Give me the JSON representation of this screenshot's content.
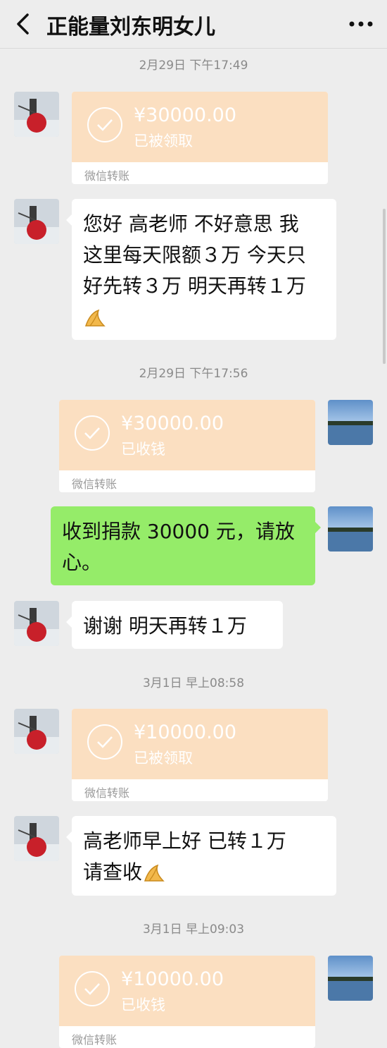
{
  "header": {
    "title": "正能量刘东明女儿"
  },
  "timestamps": [
    "2月29日 下午17:49",
    "2月29日 下午17:56",
    "3月1日 早上08:58",
    "3月1日 早上09:03"
  ],
  "messages": {
    "m1": {
      "amount": "¥30000.00",
      "status": "已被领取",
      "label": "微信转账"
    },
    "m2": {
      "lines": [
        "您好 高老师  不好意思  我",
        "这里每天限额３万  今天只",
        "好先转３万  明天再转１万"
      ]
    },
    "m3": {
      "amount": "¥30000.00",
      "status": "已收钱",
      "label": "微信转账"
    },
    "m4": {
      "lines": [
        "收到捐款 30000 元，请放",
        "心。"
      ]
    },
    "m5": {
      "lines": [
        "谢谢  明天再转１万"
      ]
    },
    "m6": {
      "amount": "¥10000.00",
      "status": "已被领取",
      "label": "微信转账"
    },
    "m7": {
      "lines": [
        "高老师早上好  已转１万",
        "请查收"
      ]
    },
    "m8": {
      "amount": "¥10000.00",
      "status": "已收钱",
      "label": "微信转账"
    }
  },
  "colors": {
    "bg": "#ededed",
    "transfer": "#fbdfc1",
    "self_bubble": "#95ec69"
  },
  "icons": {
    "back": "back-arrow-icon",
    "more": "more-dots-icon",
    "check": "check-circle-icon",
    "emoji": "pressed-hands-emoji"
  }
}
